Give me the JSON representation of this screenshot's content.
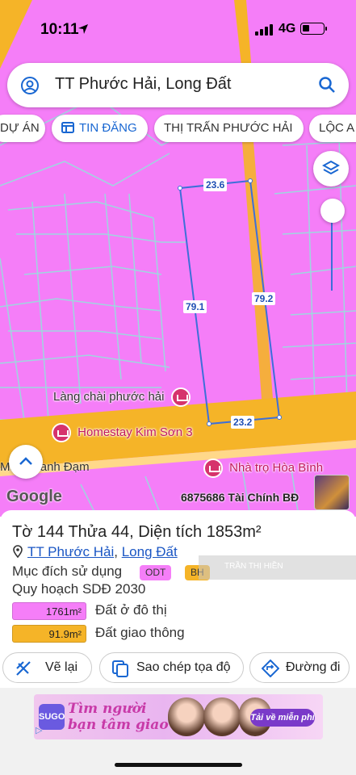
{
  "status_bar": {
    "time": "10:11",
    "network": "4G"
  },
  "search": {
    "query": "TT Phước Hải, Long Đất"
  },
  "chips": [
    {
      "label": "DỰ ÁN",
      "icon": "none"
    },
    {
      "label": "TIN ĐĂNG",
      "icon": "listing-icon",
      "active": true
    },
    {
      "label": "THỊ TRẤN PHƯỚC HẢI"
    },
    {
      "label": "LỘC A"
    }
  ],
  "map": {
    "measurements": {
      "top": "23.6",
      "left": "79.1",
      "right": "79.2",
      "bottom": "23.2"
    },
    "pois": [
      {
        "label": "Làng chài phước hải"
      },
      {
        "label": "Homestay Kim Sơn 3"
      },
      {
        "label": "Nhà trọ Hòa Bình"
      }
    ],
    "street_label": "Mạc Thanh Đạm",
    "google_logo": "Google",
    "phone_overlay": "6875686 Tài Chính BĐ",
    "colors": {
      "residential": "#f57ef8",
      "road": "#f5b428",
      "boundary": "#3d6fd9"
    }
  },
  "parcel": {
    "title": "Tờ 144 Thửa 44, Diện tích 1853m²",
    "location": {
      "ward": "TT Phước Hải",
      "separator": ", ",
      "district": "Long Đất"
    },
    "purpose_label": "Mục đích sử dụng",
    "purpose_tags": [
      "ODT",
      "BH"
    ],
    "watermark": "TRẦN THỊ HIỀN",
    "planning_label": "Quy hoạch SDĐ 2030",
    "areas": [
      {
        "value": "1761m²",
        "label": "Đất ở đô thị",
        "color": "#f57ef8"
      },
      {
        "value": "91.9m²",
        "label": "Đất giao thông",
        "color": "#f5b428"
      }
    ]
  },
  "actions": {
    "draw_label": "Vẽ lại",
    "copy_label": "Sao chép tọa độ",
    "directions_label": "Đường đi"
  },
  "ad": {
    "logo": "SUGO",
    "headline": "Tìm người bạn tâm giao",
    "cta": "Tải về miễn phí"
  }
}
